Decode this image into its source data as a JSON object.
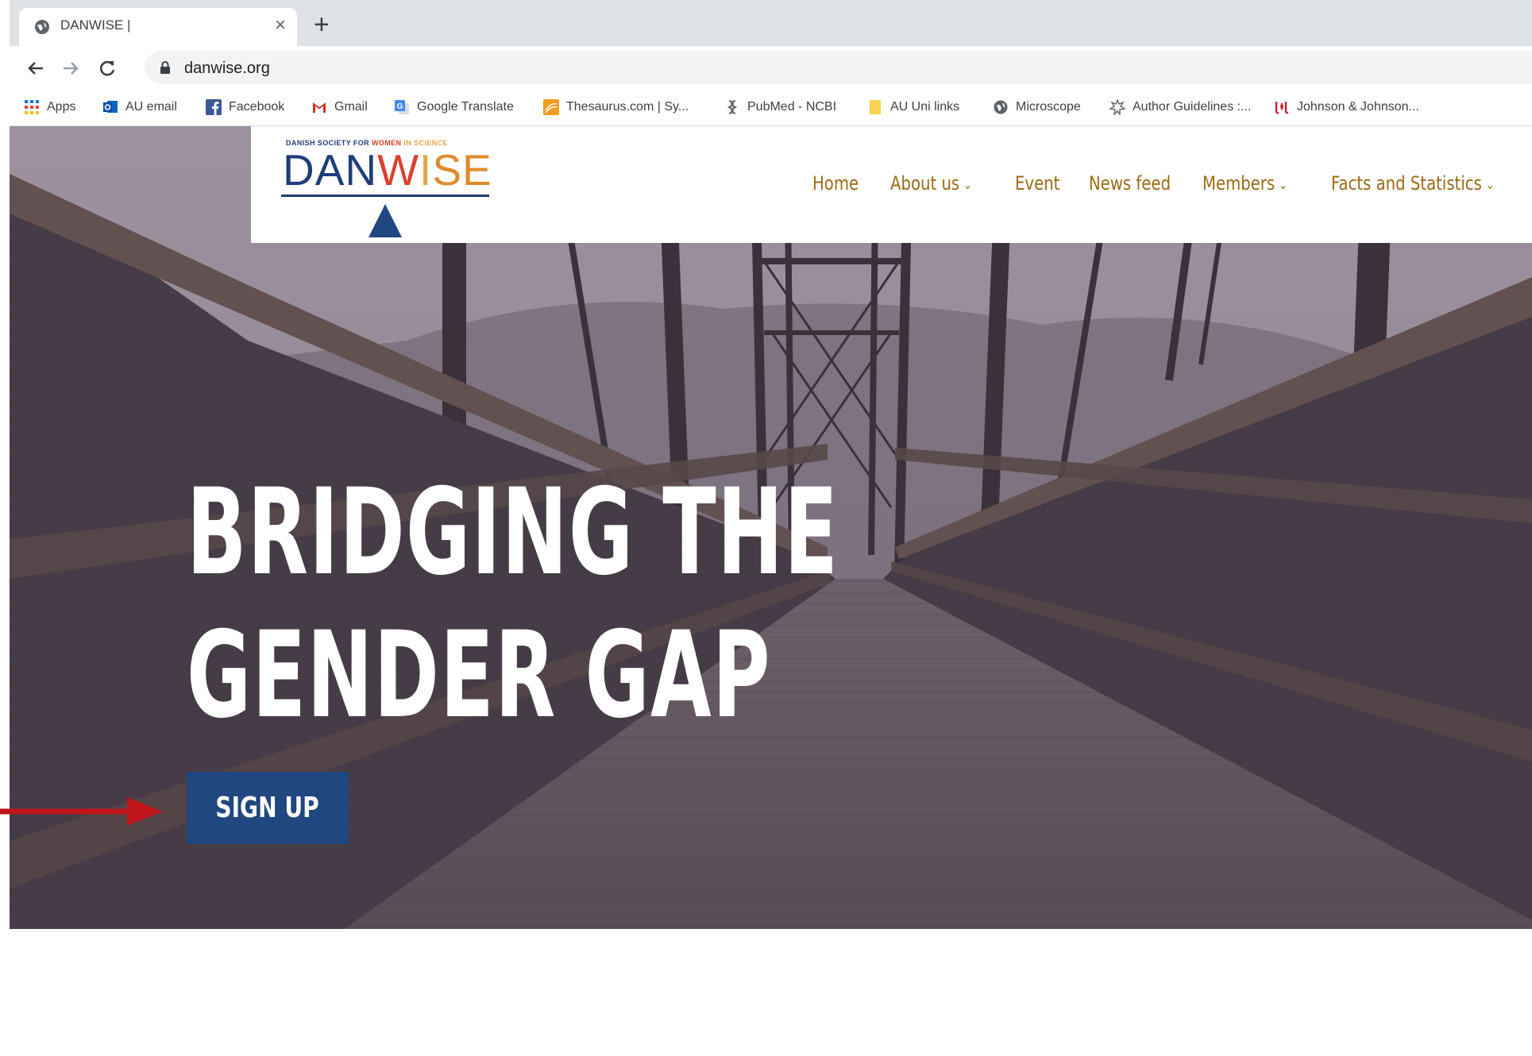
{
  "browser": {
    "tab_title": "DANWISE |",
    "tab_close": "×",
    "new_tab": "+",
    "url": "danwise.org"
  },
  "bookmarks": [
    {
      "label": "Apps",
      "icon": "apps-grid-icon"
    },
    {
      "label": "AU email",
      "icon": "outlook-icon"
    },
    {
      "label": "Facebook",
      "icon": "facebook-icon"
    },
    {
      "label": "Gmail",
      "icon": "gmail-icon"
    },
    {
      "label": "Google Translate",
      "icon": "google-translate-icon"
    },
    {
      "label": "Thesaurus.com | Sy...",
      "icon": "thesaurus-icon"
    },
    {
      "label": "PubMed - NCBI",
      "icon": "pubmed-icon"
    },
    {
      "label": "AU Uni links",
      "icon": "folder-icon"
    },
    {
      "label": "Microscope",
      "icon": "globe-icon"
    },
    {
      "label": "Author Guidelines :...",
      "icon": "author-guidelines-icon"
    },
    {
      "label": "Johnson & Johnson...",
      "icon": "jnj-icon"
    }
  ],
  "site": {
    "logo_tagline": "DANISH SOCIETY FOR WOMEN IN SCIENCE",
    "logo_tagline_parts": [
      "DANISH SOCIETY FOR ",
      "WOMEN",
      " IN ",
      "SCIENCE"
    ],
    "logo_letters": [
      "DAN",
      "W",
      "I",
      "SE"
    ],
    "nav": {
      "home": "Home",
      "about": "About us",
      "event": "Event",
      "news": "News feed",
      "members": "Members",
      "facts": "Facts and Statistics"
    },
    "headline_line1": "BRIDGING THE",
    "headline_line2": "GENDER GAP",
    "signup_label": "SIGN UP"
  },
  "colors": {
    "nav_text": "#9b6a14",
    "logo_navy": "#1f3d7a",
    "signup_bg": "#20477f",
    "arrow": "#c0141b"
  }
}
